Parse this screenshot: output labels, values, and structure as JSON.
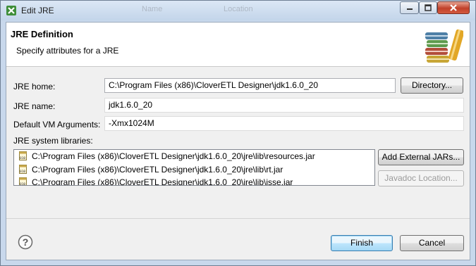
{
  "window": {
    "title": "Edit JRE",
    "ghost_columns": [
      "Name",
      "Location"
    ]
  },
  "header": {
    "title": "JRE Definition",
    "subtitle": "Specify attributes for a JRE"
  },
  "form": {
    "jre_home": {
      "label": "JRE home:",
      "value": "C:\\Program Files (x86)\\CloverETL Designer\\jdk1.6.0_20",
      "button": "Directory..."
    },
    "jre_name": {
      "label": "JRE name:",
      "value": "jdk1.6.0_20"
    },
    "vm_args": {
      "label": "Default VM Arguments:",
      "value": "-Xmx1024M"
    },
    "libraries": {
      "label": "JRE system libraries:",
      "items": [
        "C:\\Program Files (x86)\\CloverETL Designer\\jdk1.6.0_20\\jre\\lib\\resources.jar",
        "C:\\Program Files (x86)\\CloverETL Designer\\jdk1.6.0_20\\jre\\lib\\rt.jar",
        "C:\\Program Files (x86)\\CloverETL Designer\\jdk1.6.0_20\\jre\\lib\\jsse.jar"
      ],
      "add_button": "Add External JARs...",
      "javadoc_button": "Javadoc Location..."
    }
  },
  "footer": {
    "finish": "Finish",
    "cancel": "Cancel"
  }
}
